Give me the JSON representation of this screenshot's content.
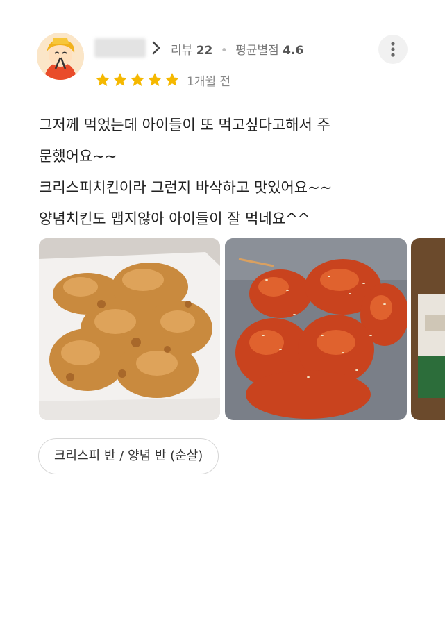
{
  "reviewer": {
    "review_count_label": "리뷰",
    "review_count": "22",
    "avg_rating_label": "평균별점",
    "avg_rating": "4.6"
  },
  "review": {
    "rating": 5,
    "max_rating": 5,
    "date": "1개월 전",
    "text_lines": [
      "그저께 먹었는데 아이들이 또 먹고싶다고해서 주",
      "문했어요~~",
      "크리스피치킨이라 그런지 바삭하고 맛있어요~~",
      "양념치킨도 맵지않아 아이들이 잘 먹네요^^"
    ],
    "menu_tag": "크리스피 반 / 양념 반 (순살)"
  },
  "colors": {
    "star": "#f5b800",
    "text": "#222222",
    "muted": "#777777",
    "more_button_bg": "#f1f1f1"
  },
  "icons": {
    "chevron": "chevron-right-icon",
    "star": "star-icon",
    "more": "more-vertical-icon"
  }
}
